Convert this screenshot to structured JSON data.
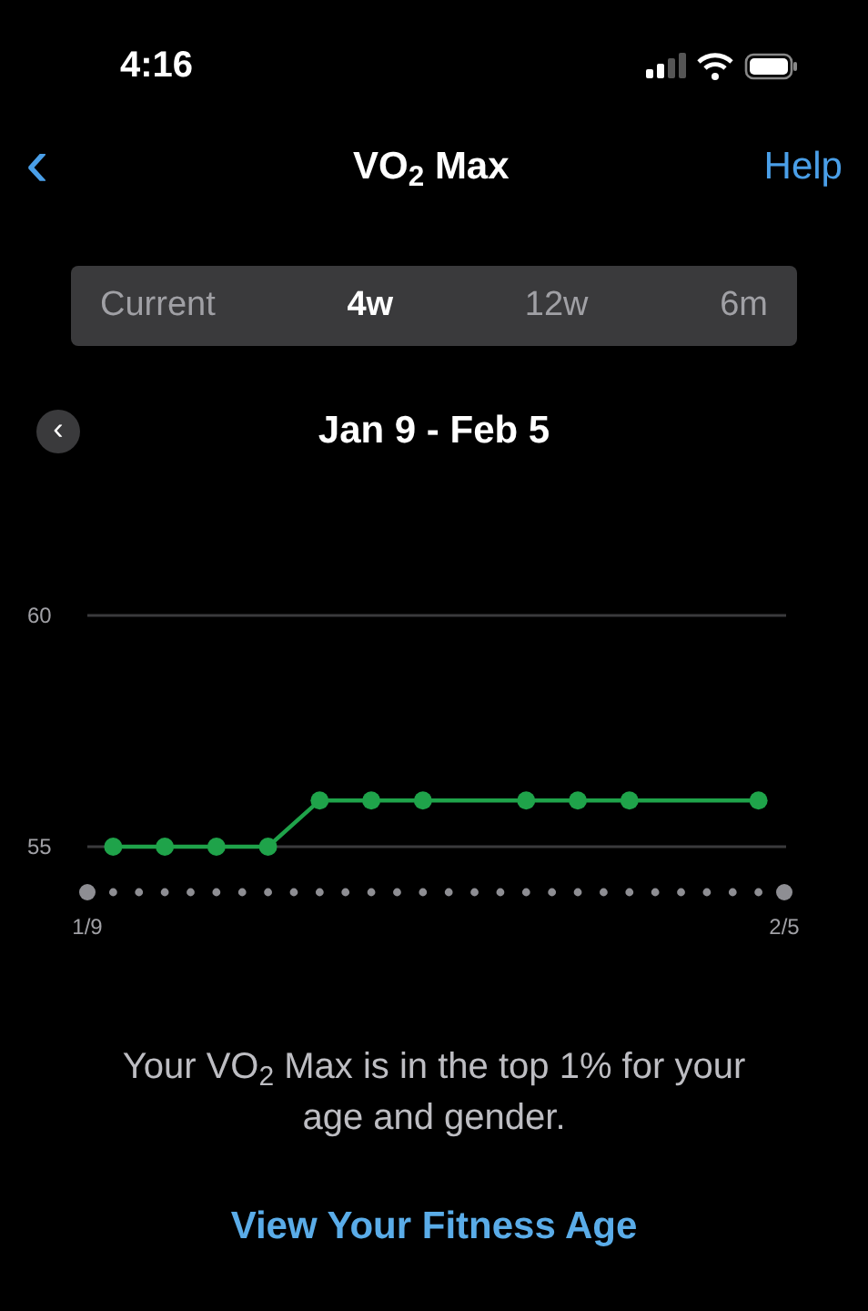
{
  "status_bar": {
    "time": "4:16"
  },
  "nav": {
    "back": "‹",
    "title": "VO$_{2}$ Max",
    "help": "Help"
  },
  "segments": [
    {
      "label": "Current",
      "selected": false
    },
    {
      "label": "4w",
      "selected": true
    },
    {
      "label": "12w",
      "selected": false
    },
    {
      "label": "6m",
      "selected": false
    }
  ],
  "range": {
    "previous": "‹",
    "label": "Jan 9 - Feb 5"
  },
  "chart": {
    "chart_data": {
      "type": "line",
      "categories": [
        "1/9",
        null,
        null,
        null,
        null,
        null,
        null,
        null,
        null,
        null,
        null,
        null,
        null,
        null,
        null,
        null,
        null,
        null,
        null,
        null,
        null,
        null,
        null,
        null,
        null,
        null,
        null,
        "2/5"
      ],
      "series": [
        {
          "color": "#1fa34a",
          "marker": "circle",
          "values": [
            null,
            55,
            null,
            55,
            null,
            55,
            null,
            55,
            null,
            56,
            null,
            56,
            null,
            56,
            null,
            null,
            null,
            56,
            null,
            56,
            null,
            56,
            null,
            null,
            null,
            null,
            56,
            null
          ]
        }
      ],
      "ylim": [
        55,
        60
      ],
      "yticks": [
        55,
        60
      ]
    }
  },
  "summary": "Your VO$_{2}$ Max is in the top 1% for your age and gender.",
  "link": "View Your Fitness Age"
}
